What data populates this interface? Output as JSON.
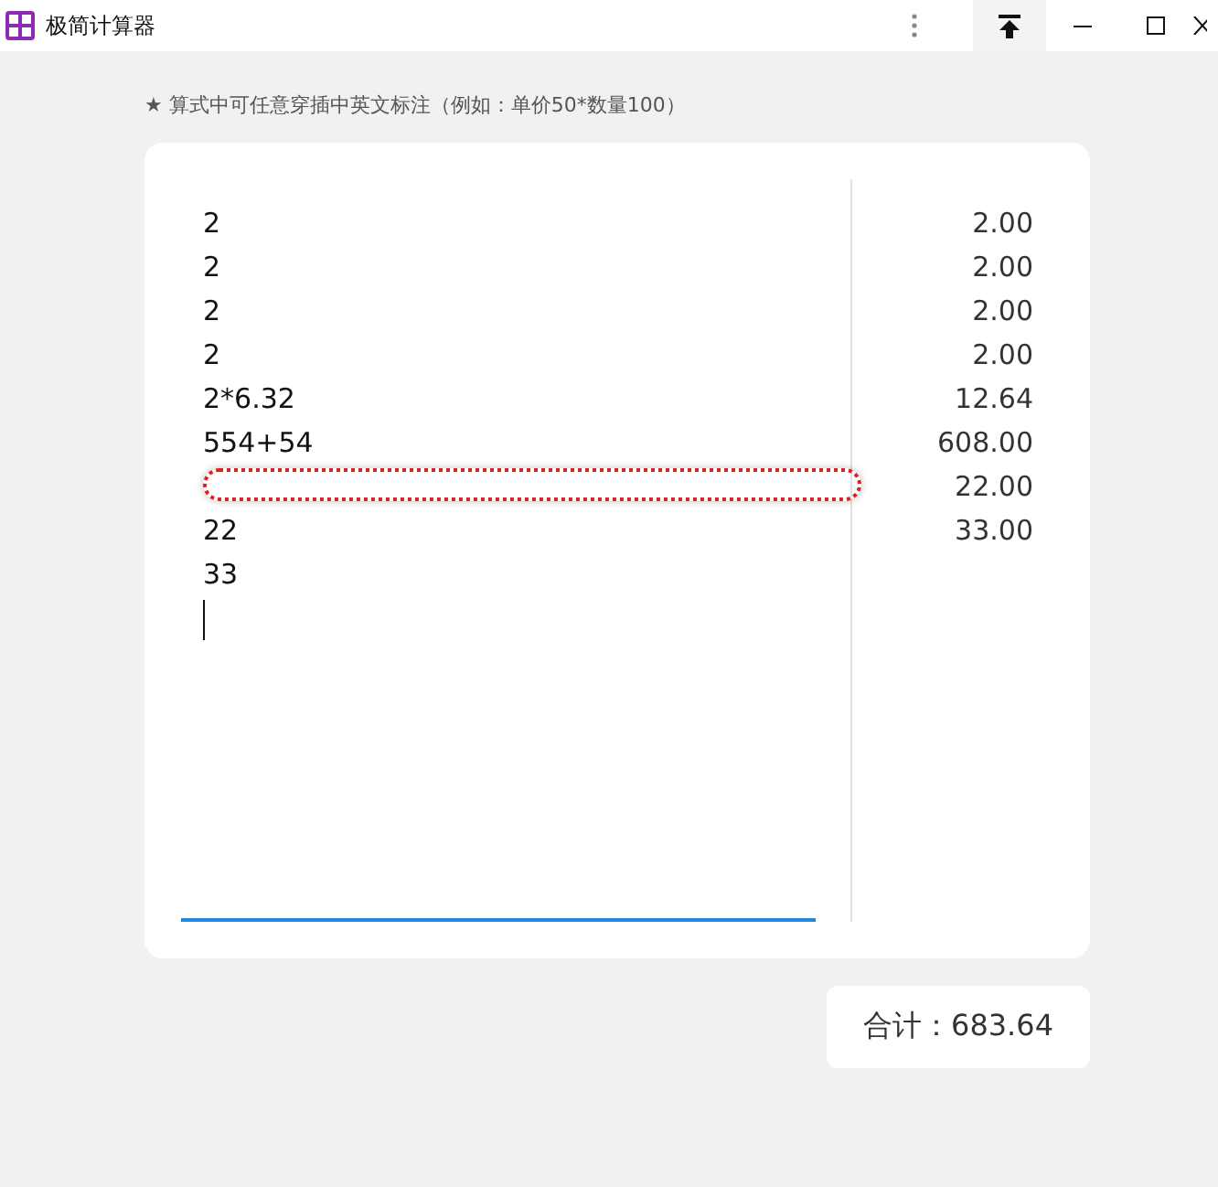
{
  "window": {
    "title": "极简计算器"
  },
  "hint": "★ 算式中可任意穿插中英文标注（例如：单价50*数量100）",
  "lines": [
    {
      "text": "2",
      "highlighted": false
    },
    {
      "text": "2",
      "highlighted": false
    },
    {
      "text": "2",
      "highlighted": false
    },
    {
      "text": "2",
      "highlighted": false
    },
    {
      "text": "2*6.32",
      "highlighted": false
    },
    {
      "text": "554+54",
      "highlighted": false
    },
    {
      "highlighted": true
    },
    {
      "text": "22",
      "highlighted": false
    },
    {
      "text": "33",
      "highlighted": false
    }
  ],
  "results": [
    "2.00",
    "2.00",
    "2.00",
    "2.00",
    "12.64",
    "608.00",
    "22.00",
    "33.00"
  ],
  "total": "合计：683.64"
}
